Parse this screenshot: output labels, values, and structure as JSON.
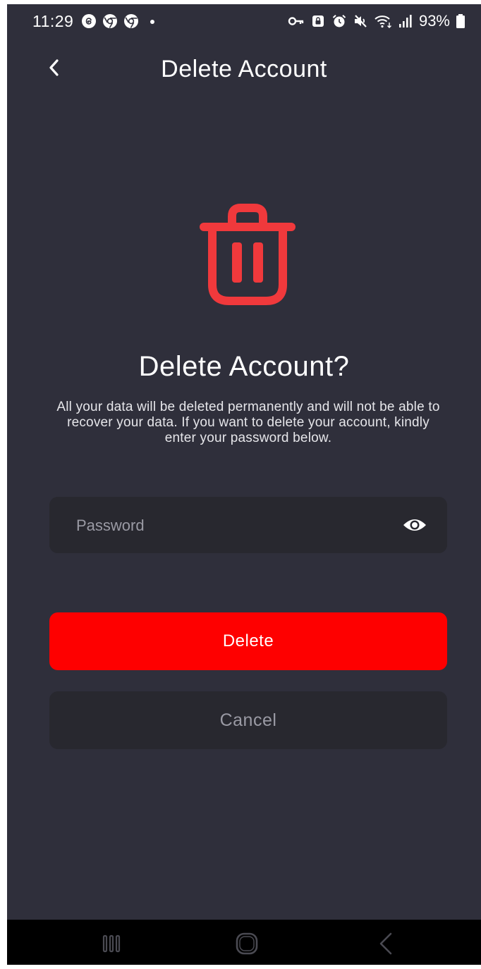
{
  "status_bar": {
    "time": "11:29",
    "battery": "93%",
    "left_icons": [
      "threads-icon",
      "chrome-icon",
      "chrome-icon",
      "notification-dot-icon"
    ],
    "right_icons": [
      "vpn-key-icon",
      "lock-icon",
      "alarm-icon",
      "mute-icon",
      "wifi-icon",
      "signal-icon",
      "battery-icon"
    ]
  },
  "header": {
    "title": "Delete Account",
    "back_icon": "chevron-left-icon"
  },
  "content": {
    "headline": "Delete Account?",
    "description": "All your data will be deleted permanently and will not be able to recover your data. If you want to delete your account, kindly enter your password below.",
    "icon": "trash-icon"
  },
  "password_field": {
    "placeholder": "Password",
    "value": "",
    "toggle_icon": "eye-icon"
  },
  "buttons": {
    "delete_label": "Delete",
    "cancel_label": "Cancel"
  },
  "nav_bar": {
    "icons": [
      "recent-apps-icon",
      "home-icon",
      "back-icon"
    ]
  },
  "colors": {
    "background": "#2f2f3b",
    "accent_red": "#fe0000",
    "icon_red": "#f0393c",
    "field_bg": "#28282f",
    "text_primary": "#ffffff",
    "text_muted": "#9a9aa4"
  }
}
